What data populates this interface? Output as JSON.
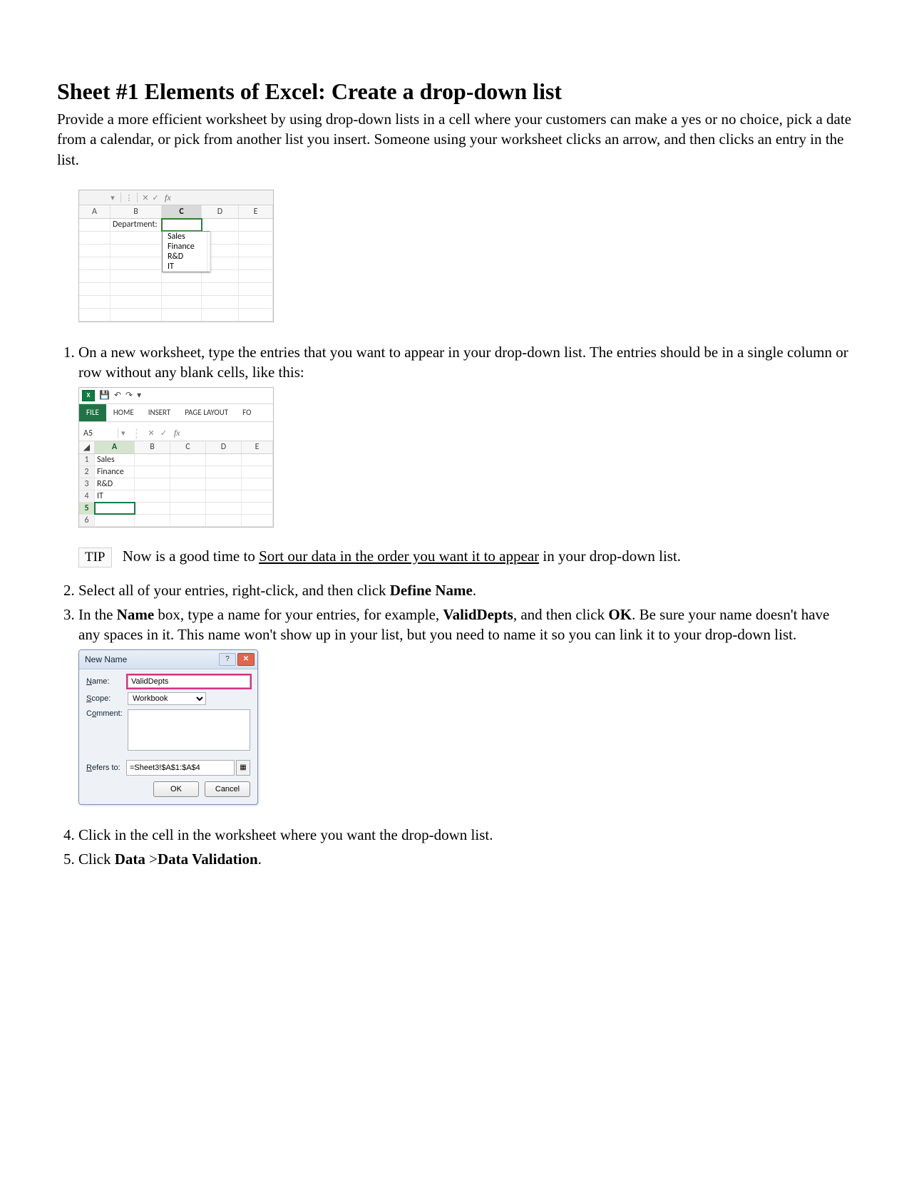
{
  "title": "Sheet #1 Elements of Excel: Create a drop-down list",
  "intro": "Provide a more efficient worksheet by using drop-down lists in a cell where your customers can make a yes or no choice, pick a date from a calendar, or pick from another list you insert. Someone using your worksheet clicks an arrow, and then clicks an entry in the list.",
  "fig1": {
    "fx_symbol": "fx",
    "columns": [
      "A",
      "B",
      "C",
      "D",
      "E"
    ],
    "label_cell": "Department:",
    "options": [
      "Sales",
      "Finance",
      "R&D",
      "IT"
    ]
  },
  "steps": {
    "s1": "On a new worksheet, type the entries that you want to appear in your drop-down list. The entries should be in a single column or row without any blank cells, like this:",
    "s2": "Select all of your entries, right-click, and then click ",
    "s2_bold": "Define Name",
    "s2_end": ".",
    "s3_a": "In the ",
    "s3_b": "Name",
    "s3_c": " box, type a name for your entries, for example, ",
    "s3_d": "ValidDepts",
    "s3_e": ", and then click ",
    "s3_f": "OK",
    "s3_g": ". Be sure your name doesn't have any spaces in it. This name won't show up in your list, but you need to name it so you can link it to your drop-down list.",
    "s4": "Click in the cell in the worksheet where you want the drop-down list.",
    "s5_a": "Click ",
    "s5_b": "Data",
    "s5_c": " >",
    "s5_d": "Data Validation",
    "s5_e": "."
  },
  "tip": {
    "badge": "TIP",
    "before": "Now is a good time to ",
    "link": "Sort our data in the order you want it to appear",
    "after": " in your drop-down list."
  },
  "fig2": {
    "logo_text": "X",
    "tabs": [
      "FILE",
      "HOME",
      "INSERT",
      "PAGE LAYOUT",
      "FO"
    ],
    "namebox": "A5",
    "fx_symbol": "fx",
    "columns": [
      "A",
      "B",
      "C",
      "D",
      "E"
    ],
    "rows": [
      {
        "n": "1",
        "a": "Sales"
      },
      {
        "n": "2",
        "a": "Finance"
      },
      {
        "n": "3",
        "a": "R&D"
      },
      {
        "n": "4",
        "a": "IT"
      },
      {
        "n": "5",
        "a": ""
      },
      {
        "n": "6",
        "a": ""
      }
    ]
  },
  "fig3": {
    "title": "New Name",
    "labels": {
      "name": "Name:",
      "scope": "Scope:",
      "comment": "Comment:",
      "refers": "Refers to:"
    },
    "name_value": "ValidDepts",
    "scope_value": "Workbook",
    "refers_value": "=Sheet3!$A$1:$A$4",
    "ok": "OK",
    "cancel": "Cancel",
    "help_symbol": "?",
    "close_symbol": "✕"
  }
}
